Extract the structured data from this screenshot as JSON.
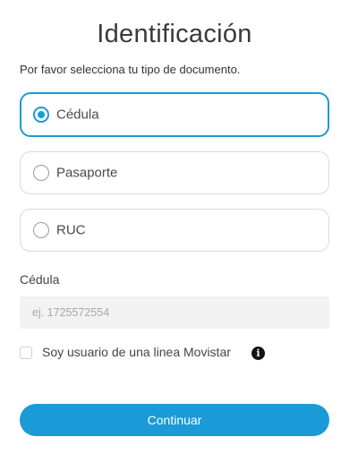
{
  "header": {
    "title": "Identificación",
    "subtitle": "Por favor selecciona tu tipo de documento."
  },
  "document_types": {
    "selected": "Cédula",
    "options": [
      {
        "label": "Cédula",
        "selected": true
      },
      {
        "label": "Pasaporte",
        "selected": false
      },
      {
        "label": "RUC",
        "selected": false
      }
    ]
  },
  "document_field": {
    "label": "Cédula",
    "value": "",
    "placeholder": "ej. 1725572554"
  },
  "movistar_user": {
    "label": "Soy usuario de una linea Movistar",
    "checked": false,
    "info_icon": "info-icon"
  },
  "actions": {
    "continue_label": "Continuar"
  },
  "colors": {
    "accent": "#1a9ad6",
    "input_background": "#f2f2f2",
    "border": "#d9d9d9"
  }
}
